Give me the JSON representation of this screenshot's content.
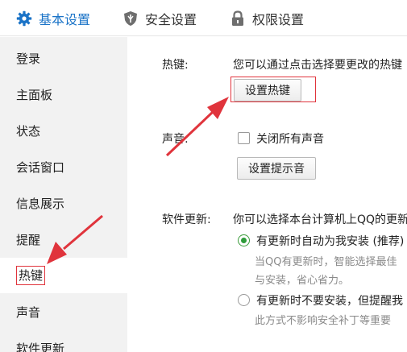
{
  "tabs": [
    {
      "label": "基本设置",
      "icon": "gear-icon",
      "active": true
    },
    {
      "label": "安全设置",
      "icon": "shield-icon",
      "active": false
    },
    {
      "label": "权限设置",
      "icon": "lock-icon",
      "active": false
    }
  ],
  "sidebar": {
    "items": [
      {
        "label": "登录"
      },
      {
        "label": "主面板"
      },
      {
        "label": "状态"
      },
      {
        "label": "会话窗口"
      },
      {
        "label": "信息展示"
      },
      {
        "label": "提醒"
      },
      {
        "label": "热键",
        "selected": true
      },
      {
        "label": "声音"
      },
      {
        "label": "软件更新"
      }
    ]
  },
  "hotkey": {
    "label": "热键:",
    "description": "您可以通过点击选择要更改的热键",
    "button": "设置热键"
  },
  "sound": {
    "label": "声音:",
    "mute_all": "关闭所有声音",
    "mute_all_checked": false,
    "button": "设置提示音"
  },
  "update": {
    "label": "软件更新:",
    "description": "你可以选择本台计算机上QQ的更新",
    "options": [
      {
        "text": "有更新时自动为我安装 (推荐)",
        "checked": true,
        "sub": [
          "当QQ有更新时，智能选择最佳",
          "与安装，省心省力。"
        ]
      },
      {
        "text": "有更新时不要安装，但提醒我",
        "checked": false,
        "sub": [
          "此方式不影响安全补丁等重要"
        ]
      }
    ]
  },
  "colors": {
    "accent": "#1a73c7",
    "highlight": "#e0343c",
    "radio_selected": "#2e9c3a",
    "sidebar_bg": "#f2f2f2"
  }
}
